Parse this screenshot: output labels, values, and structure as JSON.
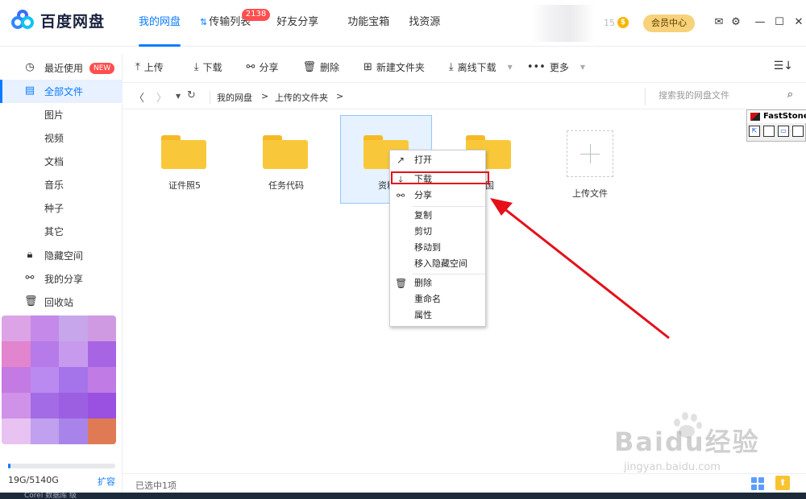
{
  "app": {
    "name": "百度网盘"
  },
  "nav": {
    "tabs": [
      {
        "label": "我的网盘",
        "active": true
      },
      {
        "label": "传输列表",
        "badge": "2138"
      },
      {
        "label": "好友分享"
      },
      {
        "label": "功能宝箱"
      },
      {
        "label": "找资源"
      }
    ]
  },
  "header": {
    "coin_count": "15",
    "coin_symbol": "$",
    "vip_label": "会员中心"
  },
  "sidebar": {
    "items": [
      {
        "label": "最近使用",
        "badge": "NEW",
        "icon": "clock-icon"
      },
      {
        "label": "全部文件",
        "active": true,
        "icon": "document-icon"
      },
      {
        "label": "图片"
      },
      {
        "label": "视频"
      },
      {
        "label": "文档"
      },
      {
        "label": "音乐"
      },
      {
        "label": "种子"
      },
      {
        "label": "其它"
      },
      {
        "label": "隐藏空间",
        "icon": "lock-icon"
      },
      {
        "label": "我的分享",
        "icon": "share-icon"
      },
      {
        "label": "回收站",
        "icon": "trash-icon"
      }
    ],
    "storage": {
      "text": "19G/5140G",
      "used_fraction": 0.0037,
      "expand_label": "扩容"
    }
  },
  "toolbar": {
    "upload": "上传",
    "download": "下载",
    "share": "分享",
    "delete": "删除",
    "new_folder": "新建文件夹",
    "offline_download": "离线下载",
    "more": "更多"
  },
  "path": {
    "crumbs": [
      "我的网盘",
      ">",
      "上传的文件夹",
      ">"
    ],
    "search_placeholder": "搜索我的网盘文件"
  },
  "files": [
    {
      "name": "证件照5",
      "type": "folder"
    },
    {
      "name": "任务代码",
      "type": "folder"
    },
    {
      "name": "资料",
      "type": "folder",
      "selected": true
    },
    {
      "name": "国",
      "type": "folder"
    },
    {
      "name": "上传文件",
      "type": "upload"
    }
  ],
  "context_menu": {
    "items": [
      {
        "label": "打开",
        "icon": "arrow-up-right-icon"
      },
      {
        "label": "下载",
        "icon": "download-icon",
        "highlighted": true
      },
      {
        "label": "分享",
        "icon": "share-icon"
      },
      {
        "label": "复制"
      },
      {
        "label": "剪切"
      },
      {
        "label": "移动到"
      },
      {
        "label": "移入隐藏空间"
      },
      {
        "label": "删除",
        "icon": "trash-icon"
      },
      {
        "label": "重命名"
      },
      {
        "label": "属性"
      }
    ]
  },
  "status": {
    "selection": "已选中1项"
  },
  "faststone": {
    "title": "FastStone"
  },
  "watermark": {
    "main": "Baidu经验",
    "sub": "jingyan.baidu.com"
  },
  "taskbar": {
    "text": "Corel    数据库 级"
  },
  "colors": {
    "accent": "#0a7cff",
    "highlight_red": "#e5101a",
    "folder": "#f9c83a",
    "vip": "#f7d27a"
  }
}
